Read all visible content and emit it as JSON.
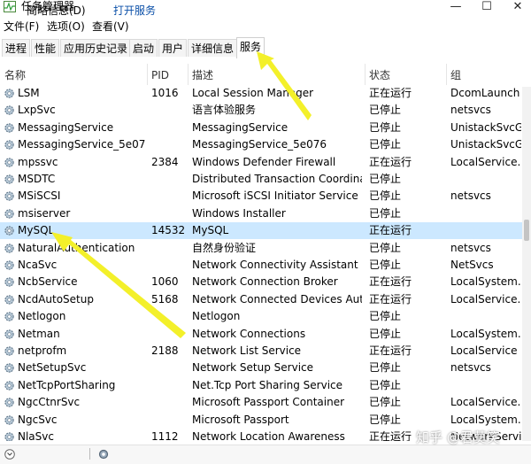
{
  "window": {
    "title": "任务管理器",
    "controls": [
      "—",
      "☐",
      "✕"
    ]
  },
  "menu": [
    {
      "label": "文件(F)"
    },
    {
      "label": "选项(O)"
    },
    {
      "label": "查看(V)"
    }
  ],
  "tabs": [
    {
      "label": "进程"
    },
    {
      "label": "性能"
    },
    {
      "label": "应用历史记录"
    },
    {
      "label": "启动"
    },
    {
      "label": "用户"
    },
    {
      "label": "详细信息"
    },
    {
      "label": "服务",
      "active": true
    }
  ],
  "columns": {
    "name": "名称",
    "pid": "PID",
    "desc": "描述",
    "status": "状态",
    "group": "组"
  },
  "services": [
    {
      "name": "LSM",
      "pid": "1016",
      "desc": "Local Session Manager",
      "status": "正在运行",
      "group": "DcomLaunch"
    },
    {
      "name": "LxpSvc",
      "pid": "",
      "desc": "语言体验服务",
      "status": "已停止",
      "group": "netsvcs"
    },
    {
      "name": "MessagingService",
      "pid": "",
      "desc": "MessagingService",
      "status": "已停止",
      "group": "UnistackSvcG..."
    },
    {
      "name": "MessagingService_5e076",
      "pid": "",
      "desc": "MessagingService_5e076",
      "status": "已停止",
      "group": "UnistackSvcG..."
    },
    {
      "name": "mpssvc",
      "pid": "2384",
      "desc": "Windows Defender Firewall",
      "status": "正在运行",
      "group": "LocalService..."
    },
    {
      "name": "MSDTC",
      "pid": "",
      "desc": "Distributed Transaction Coordina...",
      "status": "已停止",
      "group": ""
    },
    {
      "name": "MSiSCSI",
      "pid": "",
      "desc": "Microsoft iSCSI Initiator Service",
      "status": "已停止",
      "group": "netsvcs"
    },
    {
      "name": "msiserver",
      "pid": "",
      "desc": "Windows Installer",
      "status": "已停止",
      "group": ""
    },
    {
      "name": "MySQL",
      "pid": "14532",
      "desc": "MySQL",
      "status": "正在运行",
      "group": "",
      "selected": true
    },
    {
      "name": "NaturalAuthentication",
      "pid": "",
      "desc": "自然身份验证",
      "status": "已停止",
      "group": "netsvcs"
    },
    {
      "name": "NcaSvc",
      "pid": "",
      "desc": "Network Connectivity Assistant",
      "status": "已停止",
      "group": "NetSvcs"
    },
    {
      "name": "NcbService",
      "pid": "1060",
      "desc": "Network Connection Broker",
      "status": "正在运行",
      "group": "LocalSystem..."
    },
    {
      "name": "NcdAutoSetup",
      "pid": "5168",
      "desc": "Network Connected Devices Aut...",
      "status": "正在运行",
      "group": "LocalService..."
    },
    {
      "name": "Netlogon",
      "pid": "",
      "desc": "Netlogon",
      "status": "已停止",
      "group": ""
    },
    {
      "name": "Netman",
      "pid": "",
      "desc": "Network Connections",
      "status": "已停止",
      "group": "LocalSystem..."
    },
    {
      "name": "netprofm",
      "pid": "2188",
      "desc": "Network List Service",
      "status": "正在运行",
      "group": "LocalService"
    },
    {
      "name": "NetSetupSvc",
      "pid": "",
      "desc": "Network Setup Service",
      "status": "已停止",
      "group": "netsvcs"
    },
    {
      "name": "NetTcpPortSharing",
      "pid": "",
      "desc": "Net.Tcp Port Sharing Service",
      "status": "已停止",
      "group": ""
    },
    {
      "name": "NgcCtnrSvc",
      "pid": "",
      "desc": "Microsoft Passport Container",
      "status": "已停止",
      "group": "LocalService..."
    },
    {
      "name": "NgcSvc",
      "pid": "",
      "desc": "Microsoft Passport",
      "status": "已停止",
      "group": "LocalSystem..."
    },
    {
      "name": "NlaSvc",
      "pid": "1112",
      "desc": "Network Location Awareness",
      "status": "正在运行",
      "group": "NetworkService"
    }
  ],
  "footer": {
    "details": "简略信息(D)",
    "open_services": "打开服务"
  },
  "watermark": "知乎 @君莫笑",
  "colors": {
    "selected_row": "#cce8ff",
    "arrow": "#f3f02a",
    "link": "#0a4fa8"
  }
}
